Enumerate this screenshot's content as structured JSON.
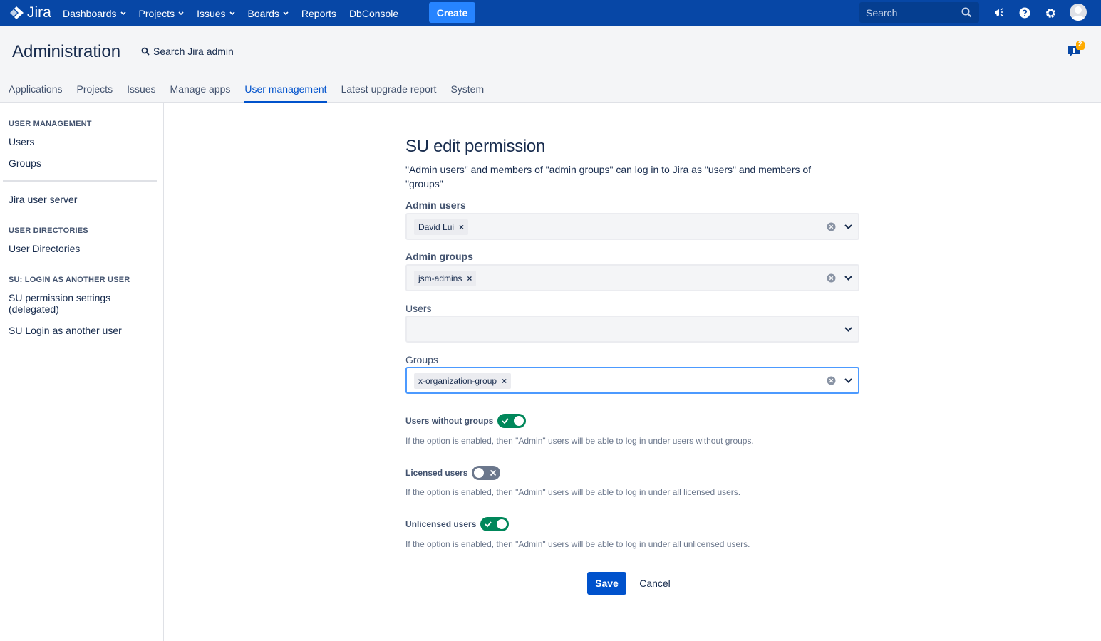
{
  "colors": {
    "nav_bg": "#0747a6",
    "create": "#2684ff",
    "primary": "#0052cc",
    "toggle_on": "#00875a",
    "toggle_off": "#6b778c"
  },
  "topnav": {
    "logo_text": "Jira",
    "items": [
      {
        "label": "Dashboards",
        "dropdown": true
      },
      {
        "label": "Projects",
        "dropdown": true
      },
      {
        "label": "Issues",
        "dropdown": true
      },
      {
        "label": "Boards",
        "dropdown": true
      },
      {
        "label": "Reports",
        "dropdown": false
      },
      {
        "label": "DbConsole",
        "dropdown": false
      }
    ],
    "create_label": "Create",
    "search_placeholder": "Search",
    "icons": [
      "megaphone-icon",
      "help-icon",
      "gear-icon",
      "avatar"
    ]
  },
  "admin": {
    "title": "Administration",
    "search_label": "Search Jira admin",
    "notification_count": "2",
    "tabs": [
      "Applications",
      "Projects",
      "Issues",
      "Manage apps",
      "User management",
      "Latest upgrade report",
      "System"
    ],
    "active_tab": "User management"
  },
  "sidebar": {
    "sections": [
      {
        "heading": "USER MANAGEMENT",
        "links": [
          "Users",
          "Groups"
        ]
      },
      {
        "heading": "",
        "links": [
          "Jira user server"
        ]
      },
      {
        "heading": "USER DIRECTORIES",
        "links": [
          "User Directories"
        ]
      },
      {
        "heading": "SU: LOGIN AS ANOTHER USER",
        "links": [
          "SU permission settings (delegated)",
          "SU Login as another user"
        ]
      }
    ]
  },
  "form": {
    "title": "SU edit permission",
    "description": "\"Admin users\" and members of \"admin groups\" can log in to Jira as \"users\" and members of \"groups\"",
    "fields": [
      {
        "label": "Admin users",
        "bold": true,
        "chip": "David Lui"
      },
      {
        "label": "Admin groups",
        "bold": true,
        "chip": "jsm-admins"
      },
      {
        "label": "Users",
        "bold": false,
        "chip": ""
      },
      {
        "label": "Groups",
        "bold": false,
        "chip": "x-organization-group"
      }
    ],
    "toggles": [
      {
        "label": "Users without groups",
        "on": true,
        "help": "If the option is enabled, then \"Admin\" users will be able to log in under users without groups."
      },
      {
        "label": "Licensed users",
        "on": false,
        "help": "If the option is enabled, then \"Admin\" users will be able to log in under all licensed users."
      },
      {
        "label": "Unlicensed users",
        "on": true,
        "help": "If the option is enabled, then \"Admin\" users will be able to log in under all unlicensed users."
      }
    ],
    "save_label": "Save",
    "cancel_label": "Cancel"
  }
}
